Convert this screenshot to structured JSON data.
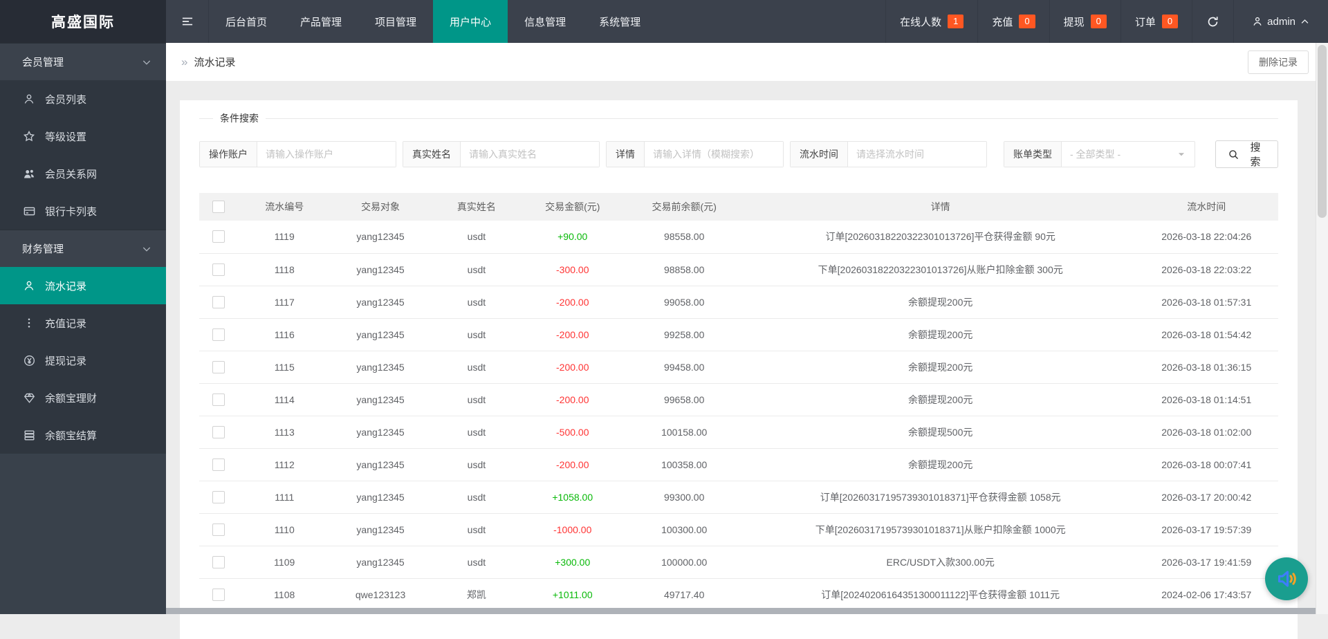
{
  "topbar": {
    "logo": "高盛国际",
    "nav": [
      "后台首页",
      "产品管理",
      "项目管理",
      "用户中心",
      "信息管理",
      "系统管理"
    ],
    "active_nav": "用户中心",
    "status": [
      {
        "label": "在线人数",
        "count": "1"
      },
      {
        "label": "充值",
        "count": "0"
      },
      {
        "label": "提现",
        "count": "0"
      },
      {
        "label": "订单",
        "count": "0"
      }
    ],
    "user": "admin"
  },
  "sidebar": {
    "active_item": "流水记录",
    "sections": [
      {
        "title": "会员管理",
        "items": [
          {
            "icon": "user-icon",
            "label": "会员列表"
          },
          {
            "icon": "star-icon",
            "label": "等级设置"
          },
          {
            "icon": "users-icon",
            "label": "会员关系网"
          },
          {
            "icon": "bank-card-icon",
            "label": "银行卡列表"
          }
        ]
      },
      {
        "title": "财务管理",
        "items": [
          {
            "icon": "user-icon",
            "label": "流水记录"
          },
          {
            "icon": "dots-icon",
            "label": "充值记录"
          },
          {
            "icon": "yen-circle-icon",
            "label": "提现记录"
          },
          {
            "icon": "diamond-icon",
            "label": "余额宝理财"
          },
          {
            "icon": "server-icon",
            "label": "余额宝结算"
          }
        ]
      }
    ]
  },
  "breadcrumb": {
    "title": "流水记录",
    "delete_button": "删除记录"
  },
  "search": {
    "legend": "条件搜索",
    "fields": [
      {
        "label": "操作账户",
        "placeholder": "请输入操作账户"
      },
      {
        "label": "真实姓名",
        "placeholder": "请输入真实姓名"
      },
      {
        "label": "详情",
        "placeholder": "请输入详情（模糊搜索）"
      },
      {
        "label": "流水时间",
        "placeholder": "请选择流水时间"
      }
    ],
    "select": {
      "label": "账单类型",
      "value": "- 全部类型 -"
    },
    "button": "搜 索"
  },
  "table": {
    "headers": [
      "流水编号",
      "交易对象",
      "真实姓名",
      "交易金额(元)",
      "交易前余额(元)",
      "详情",
      "流水时间"
    ],
    "rows": [
      {
        "id": "1119",
        "account": "yang12345",
        "real_name": "usdt",
        "amount": "+90.00",
        "balance": "98558.00",
        "detail": "订单[20260318220322301013726]平仓获得金额 90元",
        "time": "2026-03-18 22:04:26"
      },
      {
        "id": "1118",
        "account": "yang12345",
        "real_name": "usdt",
        "amount": "-300.00",
        "balance": "98858.00",
        "detail": "下单[20260318220322301013726]从账户扣除金额 300元",
        "time": "2026-03-18 22:03:22"
      },
      {
        "id": "1117",
        "account": "yang12345",
        "real_name": "usdt",
        "amount": "-200.00",
        "balance": "99058.00",
        "detail": "余额提现200元",
        "time": "2026-03-18 01:57:31"
      },
      {
        "id": "1116",
        "account": "yang12345",
        "real_name": "usdt",
        "amount": "-200.00",
        "balance": "99258.00",
        "detail": "余额提现200元",
        "time": "2026-03-18 01:54:42"
      },
      {
        "id": "1115",
        "account": "yang12345",
        "real_name": "usdt",
        "amount": "-200.00",
        "balance": "99458.00",
        "detail": "余额提现200元",
        "time": "2026-03-18 01:36:15"
      },
      {
        "id": "1114",
        "account": "yang12345",
        "real_name": "usdt",
        "amount": "-200.00",
        "balance": "99658.00",
        "detail": "余额提现200元",
        "time": "2026-03-18 01:14:51"
      },
      {
        "id": "1113",
        "account": "yang12345",
        "real_name": "usdt",
        "amount": "-500.00",
        "balance": "100158.00",
        "detail": "余额提现500元",
        "time": "2026-03-18 01:02:00"
      },
      {
        "id": "1112",
        "account": "yang12345",
        "real_name": "usdt",
        "amount": "-200.00",
        "balance": "100358.00",
        "detail": "余额提现200元",
        "time": "2026-03-18 00:07:41"
      },
      {
        "id": "1111",
        "account": "yang12345",
        "real_name": "usdt",
        "amount": "+1058.00",
        "balance": "99300.00",
        "detail": "订单[20260317195739301018371]平仓获得金额 1058元",
        "time": "2026-03-17 20:00:42"
      },
      {
        "id": "1110",
        "account": "yang12345",
        "real_name": "usdt",
        "amount": "-1000.00",
        "balance": "100300.00",
        "detail": "下单[20260317195739301018371]从账户扣除金额 1000元",
        "time": "2026-03-17 19:57:39"
      },
      {
        "id": "1109",
        "account": "yang12345",
        "real_name": "usdt",
        "amount": "+300.00",
        "balance": "100000.00",
        "detail": "ERC/USDT入款300.00元",
        "time": "2026-03-17 19:41:59"
      },
      {
        "id": "1108",
        "account": "qwe123123",
        "real_name": "郑凯",
        "amount": "+1011.00",
        "balance": "49717.40",
        "detail": "订单[20240206164351300011122]平仓获得金额 1011元",
        "time": "2024-02-06 17:43:57"
      }
    ]
  },
  "colors": {
    "accent_teal": "#009688",
    "badge_orange": "#ff5722",
    "amount_positive": "#09b909",
    "amount_negative": "#ff3434",
    "float_button": "#1a9e8f"
  }
}
